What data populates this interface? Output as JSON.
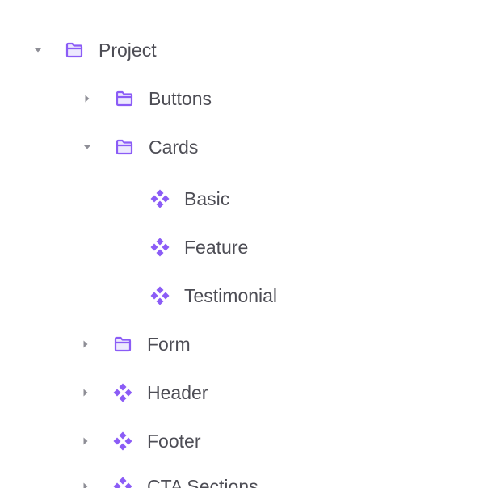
{
  "tree": {
    "accent_color": "#8b5cf6",
    "caret_color": "#8e8e96",
    "text_color": "#4d4d55",
    "items": [
      {
        "label": "Project",
        "icon": "folder-icon",
        "expanded": true,
        "has_children": true
      },
      {
        "label": "Buttons",
        "icon": "folder-icon",
        "expanded": false,
        "has_children": true
      },
      {
        "label": "Cards",
        "icon": "folder-icon",
        "expanded": true,
        "has_children": true
      },
      {
        "label": "Basic",
        "icon": "component-icon",
        "expanded": false,
        "has_children": false
      },
      {
        "label": "Feature",
        "icon": "component-icon",
        "expanded": false,
        "has_children": false
      },
      {
        "label": "Testimonial",
        "icon": "component-icon",
        "expanded": false,
        "has_children": false
      },
      {
        "label": "Form",
        "icon": "folder-icon",
        "expanded": false,
        "has_children": true
      },
      {
        "label": "Header",
        "icon": "component-icon",
        "expanded": false,
        "has_children": true
      },
      {
        "label": "Footer",
        "icon": "component-icon",
        "expanded": false,
        "has_children": true
      },
      {
        "label": "CTA Sections",
        "icon": "component-icon",
        "expanded": false,
        "has_children": true
      }
    ]
  }
}
